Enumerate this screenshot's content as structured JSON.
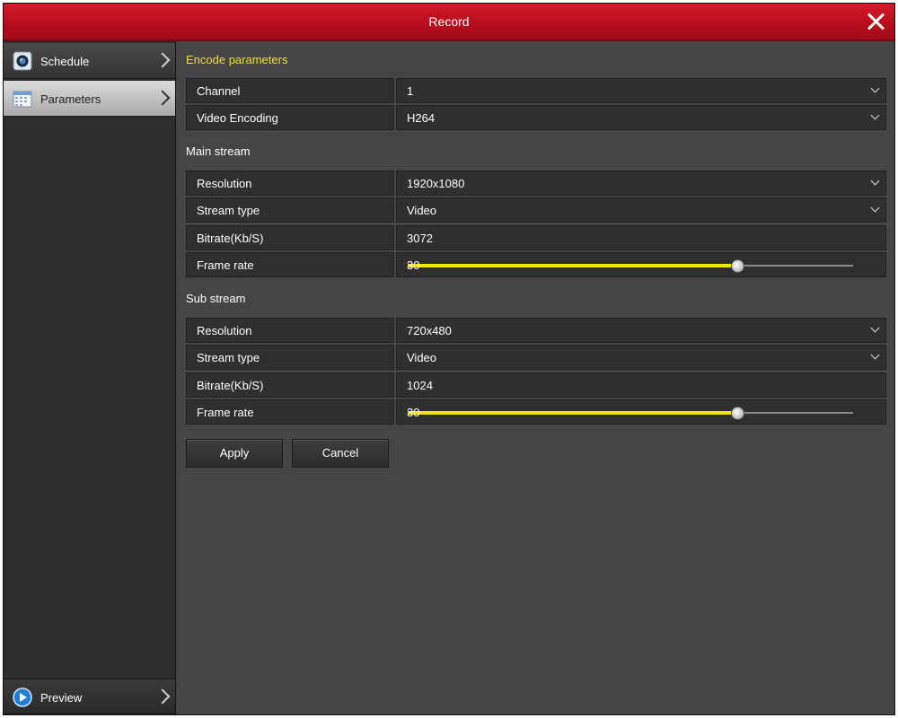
{
  "window": {
    "title": "Record"
  },
  "sidebar": {
    "items": [
      {
        "label": "Schedule",
        "icon": "camera-icon"
      },
      {
        "label": "Parameters",
        "icon": "calendar-icon"
      },
      {
        "label": "Preview",
        "icon": "play-icon"
      }
    ],
    "active_index": 1
  },
  "encode": {
    "section_title": "Encode parameters",
    "channel": {
      "label": "Channel",
      "value": "1"
    },
    "video_encoding": {
      "label": "Video Encoding",
      "value": "H264"
    }
  },
  "main_stream": {
    "section_title": "Main stream",
    "resolution": {
      "label": "Resolution",
      "value": "1920x1080"
    },
    "stream_type": {
      "label": "Stream type",
      "value": "Video"
    },
    "bitrate": {
      "label": "Bitrate(Kb/S)",
      "value": "3072"
    },
    "frame_rate": {
      "label": "Frame rate",
      "value": "30",
      "level": 0.74
    }
  },
  "sub_stream": {
    "section_title": "Sub stream",
    "resolution": {
      "label": "Resolution",
      "value": "720x480"
    },
    "stream_type": {
      "label": "Stream type",
      "value": "Video"
    },
    "bitrate": {
      "label": "Bitrate(Kb/S)",
      "value": "1024"
    },
    "frame_rate": {
      "label": "Frame rate",
      "value": "30",
      "level": 0.74
    }
  },
  "buttons": {
    "apply": "Apply",
    "cancel": "Cancel"
  },
  "colors": {
    "title_bar": "#c8101f",
    "section_title": "#f2e03a",
    "slider_fill": "#f2e600"
  }
}
